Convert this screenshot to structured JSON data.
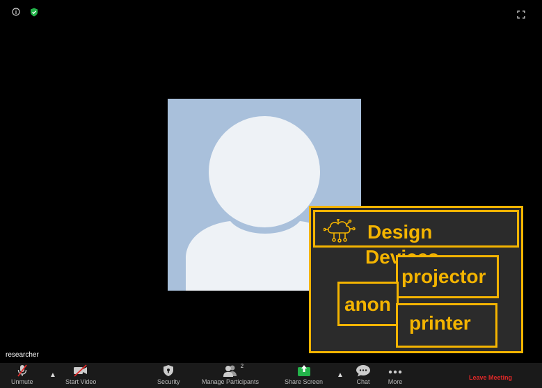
{
  "top": {
    "info_icon": "info-icon",
    "security_icon": "shield-check-icon",
    "fullscreen_icon": "expand-icon"
  },
  "video": {
    "participant_name": "researcher"
  },
  "toolbar": {
    "unmute": "Unmute",
    "start_video": "Start Video",
    "security": "Security",
    "participants": "Manage Participants",
    "participants_count": "2",
    "share": "Share Screen",
    "chat": "Chat",
    "more": "More",
    "leave": "Leave Meeting"
  },
  "overlay": {
    "title_line1": "Design",
    "title_line2": "Devices",
    "chips": [
      "projector",
      "anon",
      "printer"
    ],
    "accent": "#f4b400",
    "icon": "cloud-network-icon"
  },
  "colors": {
    "share_green": "#23b34a",
    "leave_red": "#e02828",
    "avatar_bg": "#a9c0db"
  }
}
